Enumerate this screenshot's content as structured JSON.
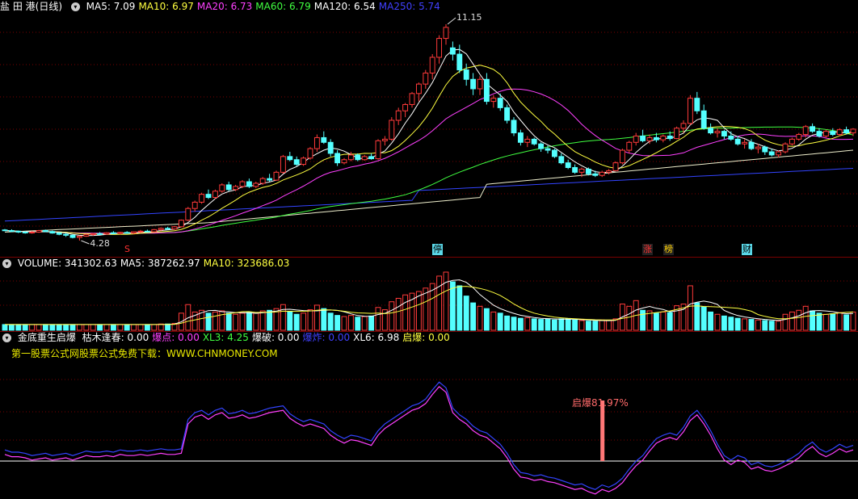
{
  "price_panel": {
    "stock_name": "盐 田 港",
    "period": "(日线)",
    "ma_items": [
      {
        "label": "MA5: 7.09",
        "color": "#ffffff"
      },
      {
        "label": "MA10: 6.97",
        "color": "#ffff40"
      },
      {
        "label": "MA20: 6.73",
        "color": "#ff40ff"
      },
      {
        "label": "MA60: 6.79",
        "color": "#40ff40"
      },
      {
        "label": "MA120: 6.54",
        "color": "#ffffff"
      },
      {
        "label": "MA250: 5.74",
        "color": "#4040ff"
      }
    ],
    "high_label": "11.15",
    "low_label": "4.28",
    "markers": [
      {
        "text": "S",
        "color": "#ff3030",
        "bg": "transparent"
      },
      {
        "text": "停",
        "color": "#000000",
        "bg": "#5bd8e8"
      },
      {
        "text": "涨",
        "color": "#ff3030",
        "bg": "#222222"
      },
      {
        "text": "榜",
        "color": "#ffd000",
        "bg": "#222222"
      },
      {
        "text": "财",
        "color": "#000000",
        "bg": "#5bd8e8"
      }
    ]
  },
  "volume_panel": {
    "items": [
      {
        "label": "VOLUME: 341302.63",
        "color": "#ffffff"
      },
      {
        "label": "MA5: 387262.97",
        "color": "#ffffff"
      },
      {
        "label": "MA10: 323686.03",
        "color": "#ffff40"
      }
    ]
  },
  "indicator_panel": {
    "name": "金底重生启爆",
    "items": [
      {
        "label": "枯木逢春: 0.00",
        "color": "#ffffff"
      },
      {
        "label": "爆点: 0.00",
        "color": "#ff40ff"
      },
      {
        "label": "XL3: 4.25",
        "color": "#40ff40"
      },
      {
        "label": "爆破: 0.00",
        "color": "#ffffff"
      },
      {
        "label": "爆炸: 0.00",
        "color": "#4040ff"
      },
      {
        "label": "XL6: 6.98",
        "color": "#ffffff"
      },
      {
        "label": "启爆: 0.00",
        "color": "#ffff40"
      }
    ],
    "ad_text": "第一股票公式网股票公式免费下载：WWW.CHNMONEY.COM",
    "signal_label": "启爆81.97%"
  },
  "colors": {
    "up": "#ff3a3a",
    "down": "#54ffff",
    "grid": "#7a0000"
  },
  "chart_data": {
    "type": "candlestick",
    "y_range": [
      4.28,
      11.15
    ],
    "candles": [
      [
        4.62,
        4.65,
        4.58,
        4.6
      ],
      [
        4.6,
        4.64,
        4.55,
        4.58
      ],
      [
        4.58,
        4.6,
        4.52,
        4.55
      ],
      [
        4.55,
        4.58,
        4.5,
        4.53
      ],
      [
        4.53,
        4.58,
        4.5,
        4.55
      ],
      [
        4.55,
        4.62,
        4.53,
        4.6
      ],
      [
        4.6,
        4.63,
        4.55,
        4.57
      ],
      [
        4.57,
        4.6,
        4.5,
        4.52
      ],
      [
        4.52,
        4.55,
        4.45,
        4.48
      ],
      [
        4.48,
        4.52,
        4.4,
        4.45
      ],
      [
        4.45,
        4.48,
        4.35,
        4.38
      ],
      [
        4.38,
        4.44,
        4.28,
        4.42
      ],
      [
        4.42,
        4.5,
        4.4,
        4.47
      ],
      [
        4.47,
        4.52,
        4.43,
        4.5
      ],
      [
        4.5,
        4.55,
        4.46,
        4.49
      ],
      [
        4.49,
        4.55,
        4.46,
        4.53
      ],
      [
        4.53,
        4.58,
        4.48,
        4.51
      ],
      [
        4.51,
        4.56,
        4.47,
        4.54
      ],
      [
        4.54,
        4.58,
        4.5,
        4.52
      ],
      [
        4.52,
        4.57,
        4.49,
        4.56
      ],
      [
        4.56,
        4.62,
        4.52,
        4.58
      ],
      [
        4.58,
        4.63,
        4.54,
        4.56
      ],
      [
        4.56,
        4.65,
        4.54,
        4.63
      ],
      [
        4.63,
        4.7,
        4.58,
        4.67
      ],
      [
        4.67,
        4.72,
        4.62,
        4.65
      ],
      [
        4.65,
        4.74,
        4.62,
        4.72
      ],
      [
        4.72,
        4.95,
        4.7,
        4.93
      ],
      [
        4.93,
        5.35,
        4.9,
        5.3
      ],
      [
        5.3,
        5.55,
        5.2,
        5.5
      ],
      [
        5.5,
        5.8,
        5.45,
        5.75
      ],
      [
        5.75,
        5.9,
        5.6,
        5.65
      ],
      [
        5.65,
        5.9,
        5.6,
        5.85
      ],
      [
        5.85,
        6.1,
        5.8,
        6.05
      ],
      [
        6.05,
        6.15,
        5.85,
        5.9
      ],
      [
        5.9,
        6.05,
        5.85,
        6.0
      ],
      [
        6.0,
        6.2,
        5.95,
        6.15
      ],
      [
        6.15,
        6.25,
        5.95,
        6.0
      ],
      [
        6.0,
        6.15,
        5.95,
        6.1
      ],
      [
        6.1,
        6.3,
        6.05,
        6.25
      ],
      [
        6.25,
        6.4,
        6.15,
        6.2
      ],
      [
        6.2,
        6.5,
        6.18,
        6.45
      ],
      [
        6.45,
        7.0,
        6.4,
        6.95
      ],
      [
        6.95,
        7.1,
        6.8,
        6.85
      ],
      [
        6.85,
        6.95,
        6.65,
        6.7
      ],
      [
        6.7,
        6.95,
        6.65,
        6.9
      ],
      [
        6.9,
        7.25,
        6.85,
        7.2
      ],
      [
        7.2,
        7.65,
        7.1,
        7.55
      ],
      [
        7.55,
        7.75,
        7.35,
        7.4
      ],
      [
        7.4,
        7.5,
        6.95,
        7.05
      ],
      [
        7.05,
        7.15,
        6.65,
        6.75
      ],
      [
        6.75,
        6.9,
        6.7,
        6.85
      ],
      [
        6.85,
        7.1,
        6.8,
        7.0
      ],
      [
        7.0,
        7.05,
        6.8,
        6.85
      ],
      [
        6.85,
        7.0,
        6.82,
        6.95
      ],
      [
        6.95,
        7.05,
        6.85,
        6.88
      ],
      [
        6.88,
        7.5,
        6.85,
        7.45
      ],
      [
        7.45,
        7.6,
        7.3,
        7.5
      ],
      [
        7.5,
        8.2,
        7.45,
        8.1
      ],
      [
        8.1,
        8.5,
        7.95,
        8.4
      ],
      [
        8.4,
        8.65,
        8.2,
        8.6
      ],
      [
        8.6,
        9.0,
        8.5,
        8.95
      ],
      [
        8.95,
        9.3,
        8.7,
        9.25
      ],
      [
        9.25,
        9.7,
        9.1,
        9.6
      ],
      [
        9.6,
        10.2,
        9.4,
        10.1
      ],
      [
        10.1,
        10.8,
        9.9,
        10.7
      ],
      [
        10.7,
        11.15,
        10.5,
        11.05
      ],
      [
        10.4,
        10.6,
        10.0,
        10.2
      ],
      [
        10.2,
        10.5,
        9.6,
        9.7
      ],
      [
        9.7,
        9.9,
        9.2,
        9.4
      ],
      [
        9.4,
        9.6,
        8.9,
        9.1
      ],
      [
        9.1,
        9.5,
        8.9,
        9.4
      ],
      [
        9.4,
        9.6,
        8.6,
        8.7
      ],
      [
        8.7,
        8.9,
        8.5,
        8.8
      ],
      [
        8.8,
        8.95,
        8.4,
        8.5
      ],
      [
        8.5,
        8.6,
        8.0,
        8.1
      ],
      [
        8.1,
        8.2,
        7.6,
        7.7
      ],
      [
        7.7,
        7.8,
        7.3,
        7.4
      ],
      [
        7.4,
        7.6,
        7.25,
        7.5
      ],
      [
        7.5,
        7.55,
        7.3,
        7.35
      ],
      [
        7.35,
        7.4,
        7.1,
        7.2
      ],
      [
        7.2,
        7.3,
        7.05,
        7.15
      ],
      [
        7.15,
        7.2,
        6.9,
        6.95
      ],
      [
        6.95,
        7.05,
        6.7,
        6.75
      ],
      [
        6.75,
        6.85,
        6.55,
        6.6
      ],
      [
        6.6,
        6.7,
        6.4,
        6.45
      ],
      [
        6.45,
        6.6,
        6.3,
        6.55
      ],
      [
        6.55,
        6.6,
        6.35,
        6.4
      ],
      [
        6.4,
        6.5,
        6.3,
        6.35
      ],
      [
        6.35,
        6.5,
        6.3,
        6.45
      ],
      [
        6.45,
        6.55,
        6.38,
        6.5
      ],
      [
        6.5,
        6.8,
        6.48,
        6.75
      ],
      [
        6.75,
        7.2,
        6.7,
        7.15
      ],
      [
        7.15,
        7.45,
        7.05,
        7.4
      ],
      [
        7.4,
        7.7,
        7.3,
        7.6
      ],
      [
        7.6,
        7.8,
        7.4,
        7.45
      ],
      [
        7.45,
        7.65,
        7.35,
        7.55
      ],
      [
        7.55,
        7.7,
        7.4,
        7.48
      ],
      [
        7.48,
        7.65,
        7.4,
        7.6
      ],
      [
        7.6,
        7.75,
        7.45,
        7.52
      ],
      [
        7.52,
        7.9,
        7.5,
        7.85
      ],
      [
        7.85,
        8.1,
        7.7,
        8.0
      ],
      [
        8.0,
        8.9,
        7.95,
        8.8
      ],
      [
        8.8,
        9.0,
        8.3,
        8.4
      ],
      [
        8.4,
        8.6,
        7.8,
        7.85
      ],
      [
        7.85,
        8.0,
        7.65,
        7.7
      ],
      [
        7.7,
        7.85,
        7.55,
        7.75
      ],
      [
        7.75,
        7.8,
        7.5,
        7.6
      ],
      [
        7.6,
        7.75,
        7.45,
        7.5
      ],
      [
        7.5,
        7.6,
        7.3,
        7.35
      ],
      [
        7.35,
        7.5,
        7.2,
        7.4
      ],
      [
        7.4,
        7.5,
        7.15,
        7.2
      ],
      [
        7.2,
        7.35,
        7.05,
        7.25
      ],
      [
        7.25,
        7.3,
        7.0,
        7.1
      ],
      [
        7.1,
        7.2,
        6.95,
        7.0
      ],
      [
        7.0,
        7.15,
        6.92,
        7.1
      ],
      [
        7.1,
        7.4,
        7.05,
        7.35
      ],
      [
        7.35,
        7.55,
        7.3,
        7.5
      ],
      [
        7.5,
        7.7,
        7.45,
        7.65
      ],
      [
        7.65,
        7.95,
        7.55,
        7.9
      ],
      [
        7.9,
        8.0,
        7.7,
        7.75
      ],
      [
        7.75,
        7.85,
        7.55,
        7.6
      ],
      [
        7.6,
        7.8,
        7.55,
        7.75
      ],
      [
        7.75,
        7.85,
        7.6,
        7.65
      ],
      [
        7.65,
        7.85,
        7.6,
        7.8
      ],
      [
        7.8,
        7.9,
        7.65,
        7.7
      ],
      [
        7.7,
        7.85,
        7.6,
        7.82
      ]
    ],
    "volume": [
      1,
      1,
      1,
      1,
      1,
      1,
      1,
      1,
      1,
      1,
      1,
      1,
      1,
      1,
      1,
      1,
      1,
      1,
      1,
      1,
      1,
      1,
      1,
      1.1,
      1.1,
      1.2,
      3,
      4.5,
      3.2,
      3.5,
      3,
      3.2,
      3.4,
      3,
      2.8,
      3,
      3.1,
      3,
      3.4,
      3.5,
      3.8,
      4.5,
      3.2,
      2.8,
      3,
      3.6,
      4.4,
      3.8,
      3,
      2.6,
      2.4,
      2.6,
      2.3,
      2.4,
      2.5,
      4,
      3.6,
      5,
      5.6,
      6.2,
      6.5,
      6.8,
      7.4,
      8.2,
      9.5,
      10.2,
      8.5,
      7.8,
      6,
      4.8,
      4.2,
      3.8,
      3.2,
      3,
      2.5,
      2.3,
      2.1,
      2.2,
      2,
      1.9,
      2,
      1.8,
      2,
      2,
      1.8,
      1.7,
      1.6,
      1.6,
      1.8,
      1.7,
      2,
      4.6,
      4.2,
      5.2,
      3.5,
      3.4,
      3,
      3.2,
      3.1,
      4.3,
      4.6,
      7.8,
      4.8,
      4.1,
      3.2,
      2.8,
      2.5,
      2.3,
      2.1,
      2,
      1.9,
      1.8,
      1.7,
      1.6,
      1.6,
      2.8,
      3.2,
      3.5,
      4.2,
      3.4,
      3,
      2.8,
      2.9,
      3.1,
      2.7,
      3.2
    ],
    "indicator": [
      0.35,
      0.33,
      0.33,
      0.32,
      0.3,
      0.31,
      0.32,
      0.3,
      0.31,
      0.32,
      0.3,
      0.32,
      0.34,
      0.33,
      0.33,
      0.34,
      0.33,
      0.35,
      0.34,
      0.34,
      0.35,
      0.34,
      0.35,
      0.36,
      0.35,
      0.35,
      0.36,
      0.62,
      0.68,
      0.7,
      0.66,
      0.7,
      0.72,
      0.67,
      0.68,
      0.7,
      0.67,
      0.68,
      0.7,
      0.72,
      0.73,
      0.74,
      0.67,
      0.63,
      0.6,
      0.62,
      0.6,
      0.58,
      0.52,
      0.48,
      0.45,
      0.48,
      0.47,
      0.45,
      0.43,
      0.52,
      0.58,
      0.62,
      0.66,
      0.7,
      0.74,
      0.76,
      0.8,
      0.88,
      0.95,
      0.9,
      0.72,
      0.66,
      0.62,
      0.56,
      0.52,
      0.5,
      0.45,
      0.4,
      0.32,
      0.22,
      0.15,
      0.14,
      0.12,
      0.13,
      0.11,
      0.1,
      0.08,
      0.06,
      0.04,
      0.05,
      0.02,
      0.0,
      0.04,
      0.02,
      0.05,
      0.1,
      0.18,
      0.25,
      0.3,
      0.38,
      0.45,
      0.48,
      0.5,
      0.48,
      0.55,
      0.65,
      0.7,
      0.62,
      0.52,
      0.4,
      0.3,
      0.26,
      0.3,
      0.28,
      0.22,
      0.24,
      0.21,
      0.2,
      0.22,
      0.25,
      0.28,
      0.32,
      0.38,
      0.42,
      0.36,
      0.33,
      0.36,
      0.4,
      0.37,
      0.39
    ],
    "signal_index": 88
  }
}
